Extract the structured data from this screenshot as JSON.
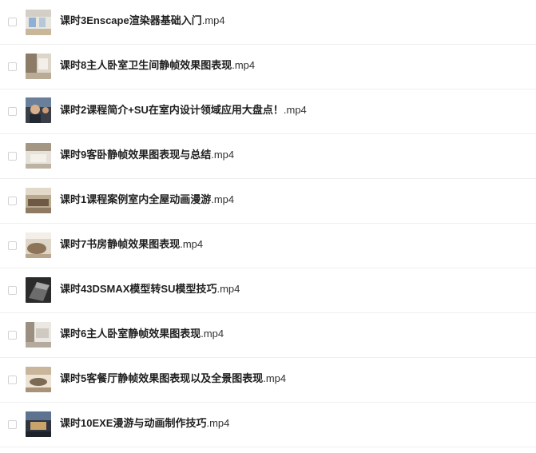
{
  "files": [
    {
      "stem": "课时3Enscape渲染器基础入门",
      "ext": ".mp4",
      "thumbnail": "gallery-room-thumbnail",
      "thumb_colors": [
        "#e8e4dc",
        "#7fa3c8",
        "#c9b79a"
      ]
    },
    {
      "stem": "课时8主人卧室卫生间静帧效果图表现",
      "ext": ".mp4",
      "thumbnail": "bathroom-thumbnail",
      "thumb_colors": [
        "#d9d2c6",
        "#8c7b67",
        "#f1ede6"
      ]
    },
    {
      "stem": "课时2课程简介+SU在室内设计领域应用大盘点！",
      "ext": ".mp4",
      "thumbnail": "presenter-thumbnail",
      "thumb_colors": [
        "#3a3f47",
        "#d8b08c",
        "#6a7f9a"
      ]
    },
    {
      "stem": "课时9客卧静帧效果图表现与总结",
      "ext": ".mp4",
      "thumbnail": "bedroom-thumbnail",
      "thumb_colors": [
        "#d6d0c7",
        "#a39683",
        "#efece6"
      ]
    },
    {
      "stem": "课时1课程案例室内全屋动画漫游",
      "ext": ".mp4",
      "thumbnail": "living-room-thumbnail",
      "thumb_colors": [
        "#b9a98f",
        "#6e5a44",
        "#e3d9c8"
      ]
    },
    {
      "stem": "课时7书房静帧效果图表现",
      "ext": ".mp4",
      "thumbnail": "study-room-thumbnail",
      "thumb_colors": [
        "#ded6c8",
        "#8d7458",
        "#f3efe8"
      ]
    },
    {
      "stem": "课时43DSMAX模型转SU模型技巧",
      "ext": ".mp4",
      "thumbnail": "3d-model-thumbnail",
      "thumb_colors": [
        "#2b2b2b",
        "#6c6c6c",
        "#a8a8a8"
      ]
    },
    {
      "stem": "课时6主人卧室静帧效果图表现",
      "ext": ".mp4",
      "thumbnail": "master-bedroom-thumbnail",
      "thumb_colors": [
        "#cfc9c0",
        "#9a8f80",
        "#ebe8e3"
      ]
    },
    {
      "stem": "课时5客餐厅静帧效果图表现以及全景图表现",
      "ext": ".mp4",
      "thumbnail": "dining-room-thumbnail",
      "thumb_colors": [
        "#c8b59a",
        "#7d6a52",
        "#ece3d4"
      ]
    },
    {
      "stem": "课时10EXE漫游与动画制作技巧",
      "ext": ".mp4",
      "thumbnail": "animation-thumbnail",
      "thumb_colors": [
        "#2e3440",
        "#c9a46a",
        "#5d7390"
      ]
    }
  ]
}
